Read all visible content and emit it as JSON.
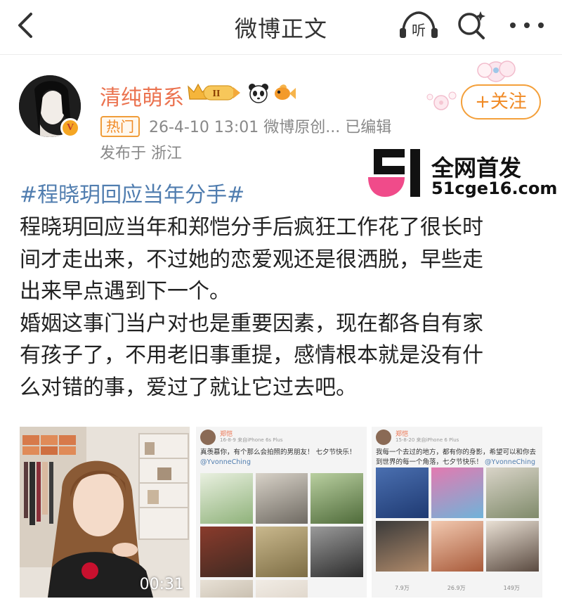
{
  "nav": {
    "title": "微博正文",
    "listen_label": "听"
  },
  "author": {
    "name": "清纯萌系",
    "vip_level": "II",
    "hot_tag": "热门",
    "meta": "26-4-10 13:01  微博原创...  已编辑",
    "location": "发布于 浙江",
    "follow_label": "+关注",
    "verified_mark": "V"
  },
  "watermark": {
    "line1": "全网首发",
    "line2": "51cge16.com"
  },
  "post": {
    "hashtag": "#程晓玥回应当年分手#",
    "lines": [
      "程晓玥回应当年和郑恺分手后疯狂工作花了很长时",
      "间才走出来，不过她的恋爱观还是很洒脱，早些走",
      "出来早点遇到下一个。",
      "婚姻这事门当户对也是重要因素，现在都各自有家",
      "有孩子了，不用老旧事重提，感情根本就是没有什",
      "么对错的事，爱过了就让它过去吧。"
    ]
  },
  "media": {
    "video_duration": "00:31",
    "shot1": {
      "name": "郑恺",
      "meta": "16-8-9  来自iPhone 6s Plus",
      "text": "真羡慕你，有个那么会拍照的男朋友！ 七夕节快乐！",
      "mention": "@YvonneChing"
    },
    "shot2": {
      "name": "郑恺",
      "meta": "15-8-20  来自iPhone 6 Plus",
      "text": "我每一个去过的地方，都有你的身影，希望可以和你去到世界的每一个角落，七夕节快乐！",
      "mention": "@YvonneChing",
      "reposts": "7.9万",
      "comments": "26.9万",
      "likes": "149万"
    }
  },
  "colors": {
    "accent_orange": "#eb7350",
    "link_blue": "#507daf",
    "meta_gray": "#888888"
  }
}
